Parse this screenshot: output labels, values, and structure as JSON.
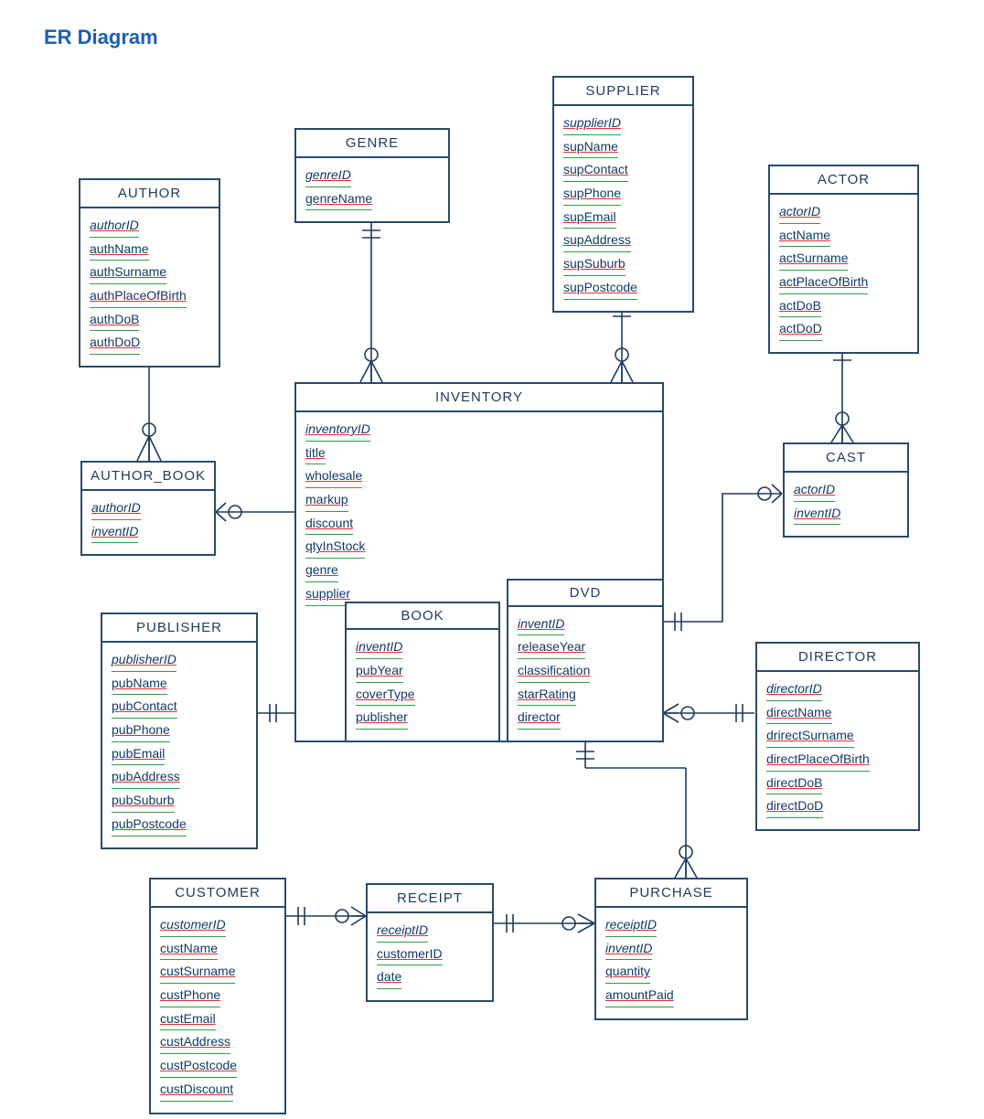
{
  "page_title": "ER Diagram",
  "entities": {
    "author": {
      "title": "AUTHOR",
      "attrs": [
        "authorID",
        "authName",
        "authSurname",
        "authPlaceOfBirth",
        "authDoB",
        "authDoD"
      ],
      "pk_indices": [
        0
      ]
    },
    "genre": {
      "title": "GENRE",
      "attrs": [
        "genreID",
        "genreName"
      ],
      "pk_indices": [
        0
      ]
    },
    "supplier": {
      "title": "SUPPLIER",
      "attrs": [
        "supplierID",
        "supName",
        "supContact",
        "supPhone",
        "supEmail",
        "supAddress",
        "supSuburb",
        "supPostcode"
      ],
      "pk_indices": [
        0
      ]
    },
    "actor": {
      "title": "ACTOR",
      "attrs": [
        "actorID",
        "actName",
        "actSurname",
        "actPlaceOfBirth",
        "actDoB",
        "actDoD"
      ],
      "pk_indices": [
        0
      ]
    },
    "author_book": {
      "title": "AUTHOR_BOOK",
      "attrs": [
        "authorID",
        "inventID"
      ],
      "pk_indices": [
        0,
        1
      ]
    },
    "inventory": {
      "title": "INVENTORY",
      "attrs": [
        "inventoryID",
        "title",
        "wholesale",
        "markup",
        "discount",
        "qtyInStock",
        "genre",
        "supplier"
      ],
      "pk_indices": [
        0
      ]
    },
    "book": {
      "title": "BOOK",
      "attrs": [
        "inventID",
        "pubYear",
        "coverType",
        "publisher"
      ],
      "pk_indices": [
        0
      ]
    },
    "dvd": {
      "title": "DVD",
      "attrs": [
        "inventID",
        "releaseYear",
        "classification",
        "starRating",
        "director"
      ],
      "pk_indices": [
        0
      ]
    },
    "cast": {
      "title": "CAST",
      "attrs": [
        "actorID",
        "inventID"
      ],
      "pk_indices": [
        0,
        1
      ]
    },
    "publisher": {
      "title": "PUBLISHER",
      "attrs": [
        "publisherID",
        "pubName",
        "pubContact",
        "pubPhone",
        "pubEmail",
        "pubAddress",
        "pubSuburb",
        "pubPostcode"
      ],
      "pk_indices": [
        0
      ]
    },
    "director": {
      "title": "DIRECTOR",
      "attrs": [
        "directorID",
        "directName",
        "drirectSurname",
        "directPlaceOfBirth",
        "directDoB",
        "directDoD"
      ],
      "pk_indices": [
        0
      ]
    },
    "customer": {
      "title": "CUSTOMER",
      "attrs": [
        "customerID",
        "custName",
        "custSurname",
        "custPhone",
        "custEmail",
        "custAddress",
        "custPostcode",
        "custDiscount"
      ],
      "pk_indices": [
        0
      ]
    },
    "receipt": {
      "title": "RECEIPT",
      "attrs": [
        "receiptID",
        "customerID",
        "date"
      ],
      "pk_indices": [
        0
      ]
    },
    "purchase": {
      "title": "PURCHASE",
      "attrs": [
        "receiptID",
        "inventID",
        "quantity",
        "amountPaid"
      ],
      "pk_indices": [
        0,
        1
      ]
    }
  },
  "chart_data": {
    "type": "table",
    "title": "ER Diagram",
    "entities": [
      {
        "name": "AUTHOR",
        "attributes": [
          "authorID",
          "authName",
          "authSurname",
          "authPlaceOfBirth",
          "authDoB",
          "authDoD"
        ]
      },
      {
        "name": "GENRE",
        "attributes": [
          "genreID",
          "genreName"
        ]
      },
      {
        "name": "SUPPLIER",
        "attributes": [
          "supplierID",
          "supName",
          "supContact",
          "supPhone",
          "supEmail",
          "supAddress",
          "supSuburb",
          "supPostcode"
        ]
      },
      {
        "name": "ACTOR",
        "attributes": [
          "actorID",
          "actName",
          "actSurname",
          "actPlaceOfBirth",
          "actDoB",
          "actDoD"
        ]
      },
      {
        "name": "AUTHOR_BOOK",
        "attributes": [
          "authorID",
          "inventID"
        ]
      },
      {
        "name": "INVENTORY",
        "attributes": [
          "inventoryID",
          "title",
          "wholesale",
          "markup",
          "discount",
          "qtyInStock",
          "genre",
          "supplier"
        ]
      },
      {
        "name": "BOOK",
        "attributes": [
          "inventID",
          "pubYear",
          "coverType",
          "publisher"
        ]
      },
      {
        "name": "DVD",
        "attributes": [
          "inventID",
          "releaseYear",
          "classification",
          "starRating",
          "director"
        ]
      },
      {
        "name": "CAST",
        "attributes": [
          "actorID",
          "inventID"
        ]
      },
      {
        "name": "PUBLISHER",
        "attributes": [
          "publisherID",
          "pubName",
          "pubContact",
          "pubPhone",
          "pubEmail",
          "pubAddress",
          "pubSuburb",
          "pubPostcode"
        ]
      },
      {
        "name": "DIRECTOR",
        "attributes": [
          "directorID",
          "directName",
          "drirectSurname",
          "directPlaceOfBirth",
          "directDoB",
          "directDoD"
        ]
      },
      {
        "name": "CUSTOMER",
        "attributes": [
          "customerID",
          "custName",
          "custSurname",
          "custPhone",
          "custEmail",
          "custAddress",
          "custPostcode",
          "custDiscount"
        ]
      },
      {
        "name": "RECEIPT",
        "attributes": [
          "receiptID",
          "customerID",
          "date"
        ]
      },
      {
        "name": "PURCHASE",
        "attributes": [
          "receiptID",
          "inventID",
          "quantity",
          "amountPaid"
        ]
      }
    ],
    "relationships": [
      {
        "from": "AUTHOR",
        "to": "AUTHOR_BOOK",
        "from_card": "one-mandatory",
        "to_card": "many-optional"
      },
      {
        "from": "AUTHOR_BOOK",
        "to": "BOOK",
        "from_card": "many-optional",
        "to_card": "one-mandatory"
      },
      {
        "from": "GENRE",
        "to": "INVENTORY",
        "from_card": "one-mandatory",
        "to_card": "many-optional"
      },
      {
        "from": "SUPPLIER",
        "to": "INVENTORY",
        "from_card": "one-mandatory",
        "to_card": "many-optional"
      },
      {
        "from": "ACTOR",
        "to": "CAST",
        "from_card": "one-mandatory",
        "to_card": "many-optional"
      },
      {
        "from": "CAST",
        "to": "DVD",
        "from_card": "many-optional",
        "to_card": "one-mandatory"
      },
      {
        "from": "PUBLISHER",
        "to": "BOOK",
        "from_card": "one-mandatory",
        "to_card": "many-optional"
      },
      {
        "from": "DIRECTOR",
        "to": "DVD",
        "from_card": "one-mandatory",
        "to_card": "many-optional"
      },
      {
        "from": "CUSTOMER",
        "to": "RECEIPT",
        "from_card": "one-mandatory",
        "to_card": "many-optional"
      },
      {
        "from": "RECEIPT",
        "to": "PURCHASE",
        "from_card": "one-mandatory",
        "to_card": "many-optional"
      },
      {
        "from": "PURCHASE",
        "to": "INVENTORY",
        "from_card": "many-optional",
        "to_card": "one-mandatory"
      }
    ]
  }
}
